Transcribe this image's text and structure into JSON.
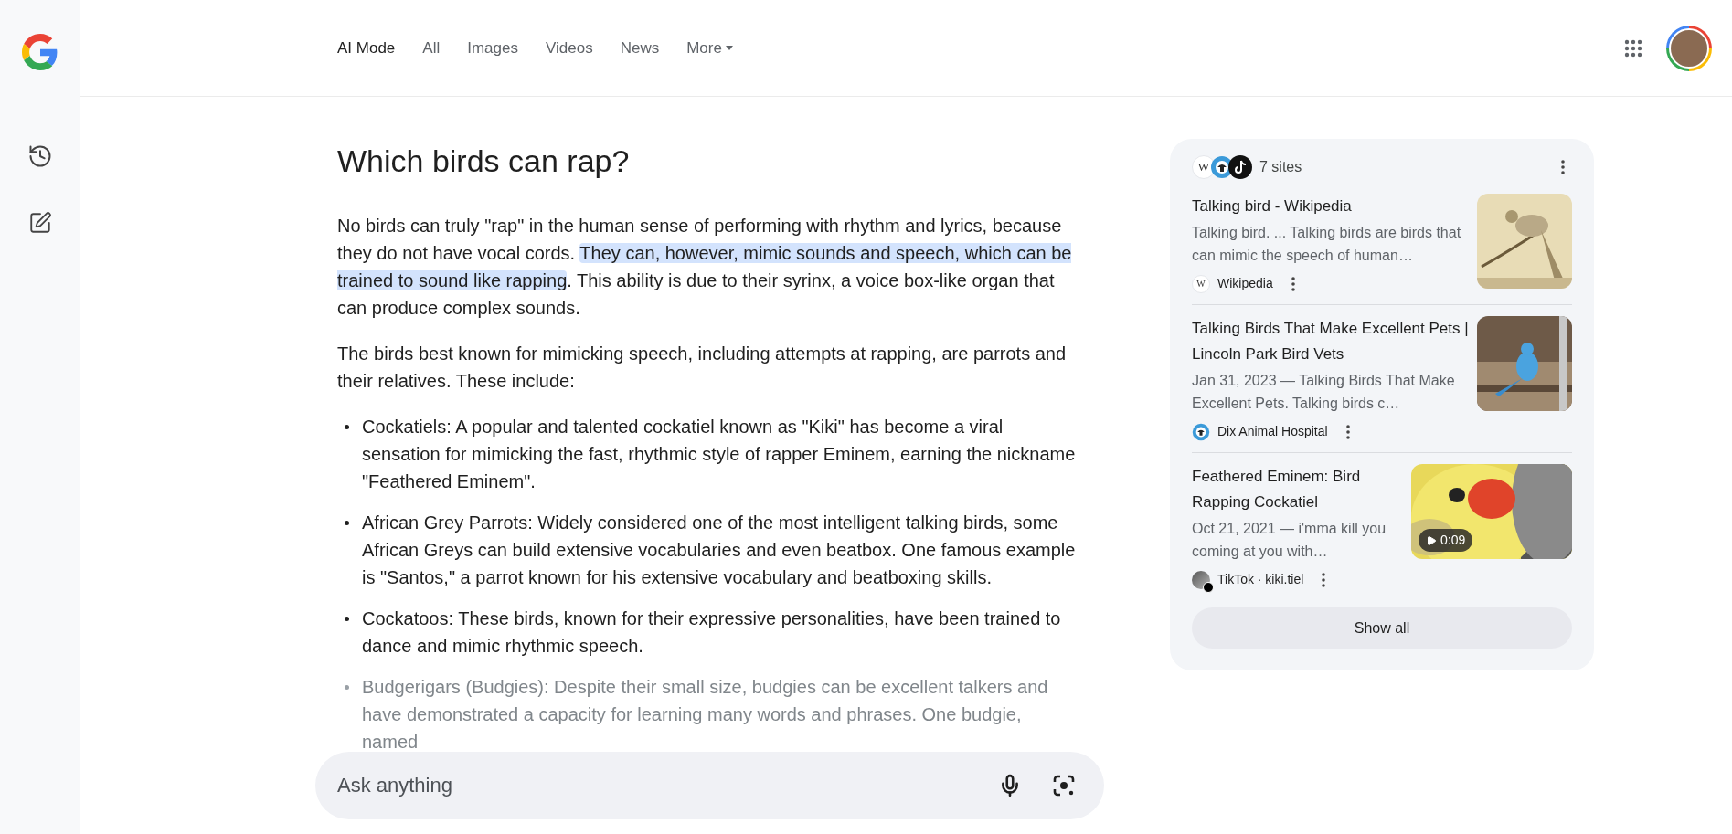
{
  "nav": {
    "tabs": [
      {
        "label": "AI Mode",
        "selected": true
      },
      {
        "label": "All",
        "selected": false
      },
      {
        "label": "Images",
        "selected": false
      },
      {
        "label": "Videos",
        "selected": false
      },
      {
        "label": "News",
        "selected": false
      },
      {
        "label": "More",
        "selected": false,
        "kind": "menu"
      }
    ]
  },
  "answer": {
    "question": "Which birds can rap?",
    "paragraphs": [
      {
        "segments": [
          {
            "text": "No birds can truly \"rap\" in the human sense of performing with rhythm and lyrics, because they do not have vocal cords. ",
            "highlighted": false
          },
          {
            "text": "They can, however, mimic sounds and speech, which can be trained to sound like rapping",
            "highlighted": true
          },
          {
            "text": ". This ability is due to their syrinx, a voice box-like organ that can produce complex sounds.",
            "highlighted": false
          }
        ]
      },
      {
        "segments": [
          {
            "text": "The birds best known for mimicking speech, including attempts at rapping, are parrots and their relatives. These include:",
            "highlighted": false
          }
        ]
      }
    ],
    "bullets": [
      {
        "text": "Cockatiels: A popular and talented cockatiel known as \"Kiki\" has become a viral sensation for mimicking the fast, rhythmic style of rapper Eminem, earning the nickname \"Feathered Eminem\".",
        "faded": false
      },
      {
        "text": "African Grey Parrots: Widely considered one of the most intelligent talking birds, some African Greys can build extensive vocabularies and even beatbox. One famous example is \"Santos,\" a parrot known for his extensive vocabulary and beatboxing skills.",
        "faded": false
      },
      {
        "text": "Cockatoos: These birds, known for their expressive personalities, have been trained to dance and mimic rhythmic speech.",
        "faded": false
      },
      {
        "text": "Budgerigars (Budgies): Despite their small size, budgies can be excellent talkers and have demonstrated a capacity for learning many words and phrases. One budgie, named",
        "faded": true
      }
    ]
  },
  "sources_panel": {
    "site_icons": [
      {
        "kind": "letter",
        "text": "W"
      },
      {
        "kind": "dix"
      },
      {
        "kind": "tiktok"
      }
    ],
    "count": "7 sites",
    "sources": [
      {
        "title": "Talking bird - Wikipedia",
        "snippet": "Talking bird. ... Talking birds are birds that can mimic the speech of human…",
        "favicon": {
          "kind": "letter",
          "text": "W"
        },
        "site": "Wikipedia"
      },
      {
        "title": "Talking Birds That Make Excellent Pets | Lincoln Park Bird Vets",
        "snippet": "Jan 31, 2023 — Talking Birds That Make Excellent Pets. Talking birds c…",
        "favicon": {
          "kind": "dix"
        },
        "site": "Dix Animal Hospital"
      },
      {
        "title": "Feathered Eminem: Bird Rapping Cockatiel",
        "snippet": "Oct 21, 2021 — i'mma kill you coming at you with…",
        "favicon": {
          "kind": "avatar"
        },
        "site": "TikTok · kiki.tiel",
        "thumbnail": {
          "kind": "video",
          "duration": "0:09"
        }
      }
    ],
    "show_all": "Show all"
  },
  "search": {
    "placeholder": "Ask anything"
  }
}
